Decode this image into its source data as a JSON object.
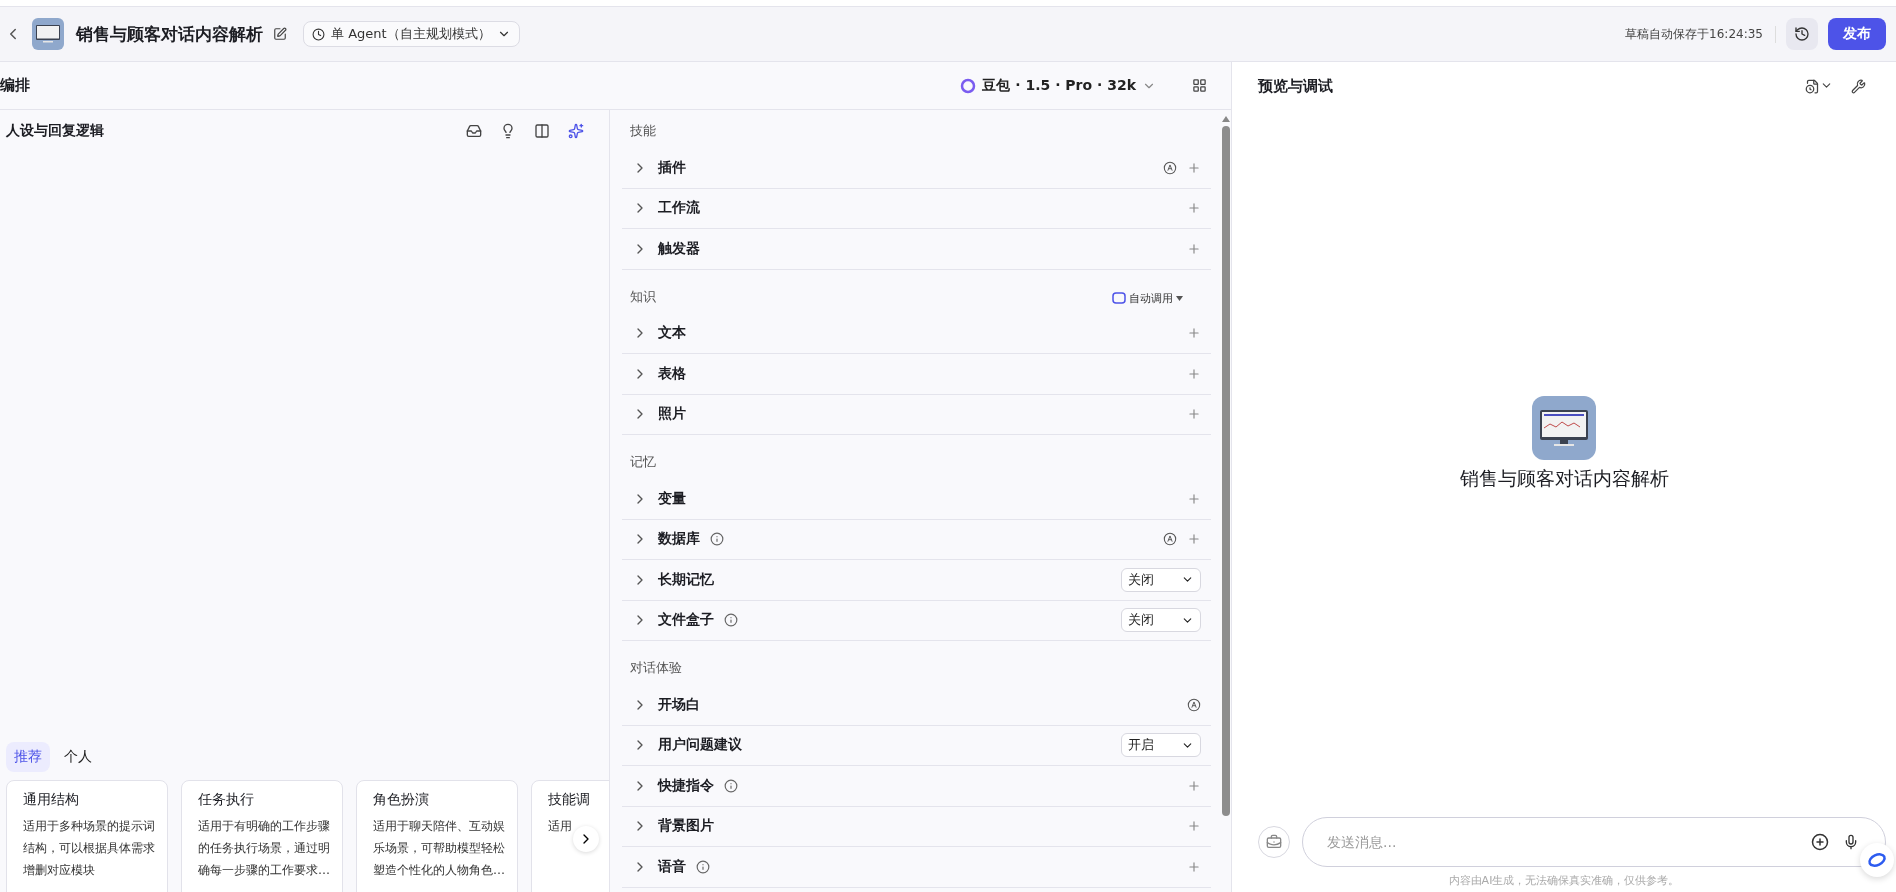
{
  "top_bar": {
    "title": "销售与顾客对话内容解析",
    "mode": "单 Agent（自主规划模式）",
    "save_status": "草稿自动保存于16:24:35",
    "publish": "发布"
  },
  "arrange": {
    "title": "编排",
    "model": "豆包 · 1.5 · Pro · 32k"
  },
  "persona": {
    "title": "人设与回复逻辑"
  },
  "template_tabs": [
    {
      "label": "推荐",
      "selected": true
    },
    {
      "label": "个人",
      "selected": false
    }
  ],
  "template_cards": [
    {
      "title": "通用结构",
      "description": "适用于多种场景的提示词结构，可以根据具体需求增删对应模块"
    },
    {
      "title": "任务执行",
      "description": "适用于有明确的工作步骤的任务执行场景，通过明确每一步骤的工作要求…"
    },
    {
      "title": "角色扮演",
      "description": "适用于聊天陪伴、互动娱乐场景，可帮助模型轻松塑造个性化的人物角色…"
    },
    {
      "title": "技能调",
      "description": "适用"
    }
  ],
  "sections": [
    {
      "title": "技能",
      "items": [
        {
          "name": "插件",
          "info": false,
          "auto": true,
          "add": true
        },
        {
          "name": "工作流",
          "info": false,
          "auto": false,
          "add": true
        },
        {
          "name": "触发器",
          "info": false,
          "auto": false,
          "add": true
        }
      ]
    },
    {
      "title": "知识",
      "action": "自动调用",
      "items": [
        {
          "name": "文本",
          "info": false,
          "auto": false,
          "add": true
        },
        {
          "name": "表格",
          "info": false,
          "auto": false,
          "add": true
        },
        {
          "name": "照片",
          "info": false,
          "auto": false,
          "add": true
        }
      ]
    },
    {
      "title": "记忆",
      "items": [
        {
          "name": "变量",
          "info": false,
          "auto": false,
          "add": true
        },
        {
          "name": "数据库",
          "info": true,
          "auto": true,
          "add": true
        },
        {
          "name": "长期记忆",
          "info": false,
          "auto": false,
          "add": false,
          "select": "关闭"
        },
        {
          "name": "文件盒子",
          "info": true,
          "auto": false,
          "add": false,
          "select": "关闭"
        }
      ]
    },
    {
      "title": "对话体验",
      "items": [
        {
          "name": "开场白",
          "info": false,
          "auto": true,
          "add": false
        },
        {
          "name": "用户问题建议",
          "info": false,
          "auto": false,
          "add": false,
          "select": "开启"
        },
        {
          "name": "快捷指令",
          "info": true,
          "auto": false,
          "add": true
        },
        {
          "name": "背景图片",
          "info": false,
          "auto": false,
          "add": true
        },
        {
          "name": "语音",
          "info": true,
          "auto": false,
          "add": true
        }
      ]
    }
  ],
  "preview": {
    "title": "预览与调试",
    "bot_name": "销售与顾客对话内容解析",
    "input": {
      "placeholder": "发送消息..."
    },
    "disclaimer": "内容由AI生成，无法确保真实准确，仅供参考。"
  }
}
